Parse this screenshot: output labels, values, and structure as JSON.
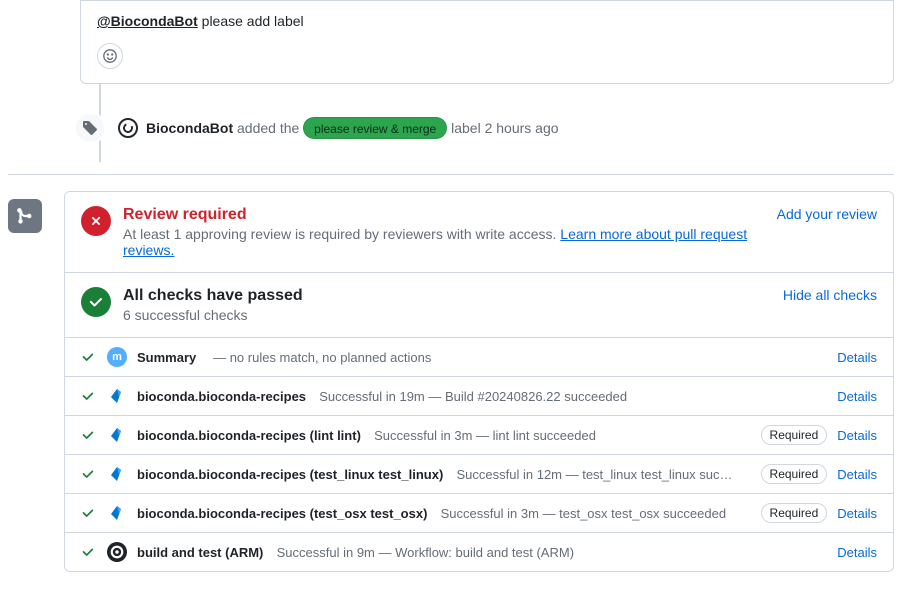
{
  "comment": {
    "mention": "@BiocondaBot",
    "rest": " please add label"
  },
  "event": {
    "actor": "BiocondaBot",
    "pre_label": " added the ",
    "label": "please review & merge",
    "post_label": " label 2 hours ago"
  },
  "review": {
    "title": "Review required",
    "sub_pre": "At least 1 approving review is required by reviewers with write access. ",
    "link": "Learn more about pull request reviews.",
    "action": "Add your review"
  },
  "checks_header": {
    "title": "All checks have passed",
    "sub": "6 successful checks",
    "action": "Hide all checks"
  },
  "required_label": "Required",
  "details_label": "Details",
  "checks": [
    {
      "avatar": "m",
      "avatar_bg": "#54aeff",
      "avatar_fg": "#ffffff",
      "name": "Summary",
      "detail": " — no rules match, no planned actions",
      "required": false
    },
    {
      "avatar": "az",
      "avatar_bg": "#ffffff",
      "avatar_fg": "#0969da",
      "name": "bioconda.bioconda-recipes",
      "detail": "Successful in 19m — Build #20240826.22 succeeded",
      "required": false
    },
    {
      "avatar": "az",
      "avatar_bg": "#ffffff",
      "avatar_fg": "#0969da",
      "name": "bioconda.bioconda-recipes (lint lint)",
      "detail": "Successful in 3m — lint lint succeeded",
      "required": true
    },
    {
      "avatar": "az",
      "avatar_bg": "#ffffff",
      "avatar_fg": "#0969da",
      "name": "bioconda.bioconda-recipes (test_linux test_linux)",
      "detail": "Successful in 12m — test_linux test_linux suc…",
      "required": true
    },
    {
      "avatar": "az",
      "avatar_bg": "#ffffff",
      "avatar_fg": "#0969da",
      "name": "bioconda.bioconda-recipes (test_osx test_osx)",
      "detail": "Successful in 3m — test_osx test_osx succeeded",
      "required": true
    },
    {
      "avatar": "cc",
      "avatar_bg": "#1f2328",
      "avatar_fg": "#ffffff",
      "name": "build and test (ARM)",
      "detail": "Successful in 9m — Workflow: build and test (ARM)",
      "required": false
    }
  ]
}
